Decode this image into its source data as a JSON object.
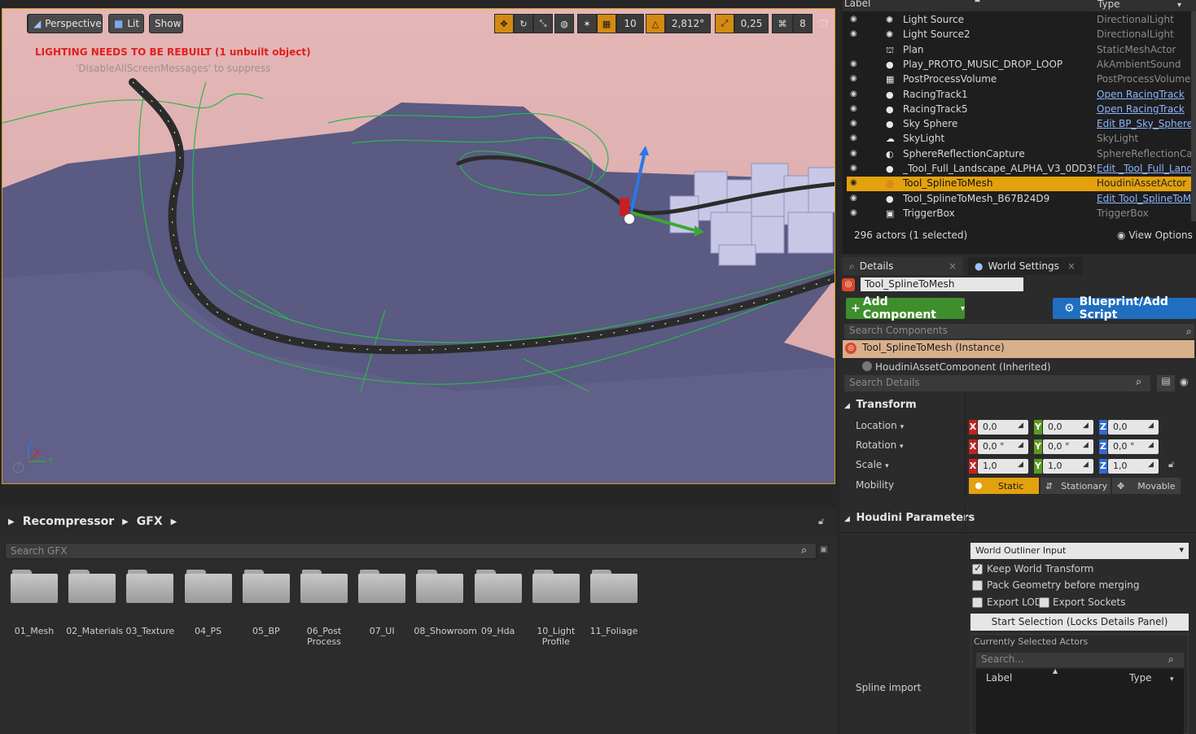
{
  "viewport": {
    "perspective_label": "Perspective",
    "lit_label": "Lit",
    "show_label": "Show",
    "grid_snap": "10",
    "rotation_snap": "2,812°",
    "scale_snap": "0,25",
    "camera_speed": "8",
    "warning": "LIGHTING NEEDS TO BE REBUILT (1 unbuilt object)",
    "hint": "'DisableAllScreenMessages' to suppress",
    "axis_z": "Z",
    "axis_x": "X",
    "axis_y": "Y",
    "help": "?"
  },
  "content_browser": {
    "path": [
      "Recompressor",
      "GFX"
    ],
    "search_placeholder": "Search GFX",
    "folders": [
      "01_Mesh",
      "02_Materials",
      "03_Texture",
      "04_PS",
      "05_BP",
      "06_Post Process",
      "07_UI",
      "08_Showroom",
      "09_Hda",
      "10_Light Profile",
      "11_Foliage"
    ]
  },
  "outliner": {
    "col_label": "Label",
    "col_type": "Type",
    "rows": [
      {
        "name": "Light Source",
        "type": "DirectionalLight",
        "icon": "directional-light-icon",
        "link": false
      },
      {
        "name": "Light Source2",
        "type": "DirectionalLight",
        "icon": "directional-light-icon",
        "link": false
      },
      {
        "name": "Plan",
        "type": "StaticMeshActor",
        "icon": "static-mesh-icon",
        "link": false
      },
      {
        "name": "Play_PROTO_MUSIC_DROP_LOOP",
        "type": "AkAmbientSound",
        "icon": "sphere-icon",
        "link": false
      },
      {
        "name": "PostProcessVolume",
        "type": "PostProcessVolume",
        "icon": "volume-icon",
        "link": false
      },
      {
        "name": "RacingTrack1",
        "type": "Open RacingTrack",
        "icon": "sphere-icon",
        "link": true
      },
      {
        "name": "RacingTrack5",
        "type": "Open RacingTrack",
        "icon": "sphere-icon",
        "link": true
      },
      {
        "name": "Sky Sphere",
        "type": "Edit BP_Sky_Sphere",
        "icon": "sphere-icon",
        "link": true
      },
      {
        "name": "SkyLight",
        "type": "SkyLight",
        "icon": "skylight-icon",
        "link": false
      },
      {
        "name": "SphereReflectionCapture",
        "type": "SphereReflectionCapt",
        "icon": "reflection-icon",
        "link": false
      },
      {
        "name": "_Tool_Full_Landscape_ALPHA_V3_0DD399(",
        "type": "Edit _Tool_Full_Land",
        "icon": "sphere-icon",
        "link": true
      },
      {
        "name": "Tool_SplineToMesh",
        "type": "HoudiniAssetActor",
        "icon": "houdini-icon",
        "link": false,
        "selected": true
      },
      {
        "name": "Tool_SplineToMesh_B67B24D9",
        "type": "Edit Tool_SplineToM",
        "icon": "sphere-icon",
        "link": true
      },
      {
        "name": "TriggerBox",
        "type": "TriggerBox",
        "icon": "triggerbox-icon",
        "link": false
      }
    ],
    "actors_count": "296 actors (1 selected)",
    "view_options": "View Options"
  },
  "details": {
    "tab_details": "Details",
    "tab_world_settings": "World Settings",
    "actor_name": "Tool_SplineToMesh",
    "add_component": "Add Component",
    "blueprint_button": "Blueprint/Add Script",
    "search_components": "Search Components",
    "instance_label": "Tool_SplineToMesh (Instance)",
    "inherited_label": "HoudiniAssetComponent (Inherited)",
    "search_details": "Search Details",
    "transform_title": "Transform",
    "location_label": "Location",
    "rotation_label": "Rotation",
    "scale_label": "Scale",
    "mobility_label": "Mobility",
    "location": [
      "0,0",
      "0,0",
      "0,0"
    ],
    "rotation": [
      "0,0 °",
      "0,0 °",
      "0,0 °"
    ],
    "scale": [
      "1,0",
      "1,0",
      "1,0"
    ],
    "mobility_static": "Static",
    "mobility_stationary": "Stationary",
    "mobility_movable": "Movable",
    "houdini_title": "Houdini Parameters",
    "input_type": "World Outliner Input",
    "keep_world_transform": "Keep World Transform",
    "pack_geometry": "Pack Geometry before merging",
    "export_lods": "Export LODs",
    "export_sockets": "Export Sockets",
    "start_selection": "Start Selection (Locks Details Panel)",
    "currently_selected": "Currently Selected Actors",
    "search_actors": "Search...",
    "spline_import": "Spline import",
    "col_label": "Label",
    "col_type": "Type"
  }
}
